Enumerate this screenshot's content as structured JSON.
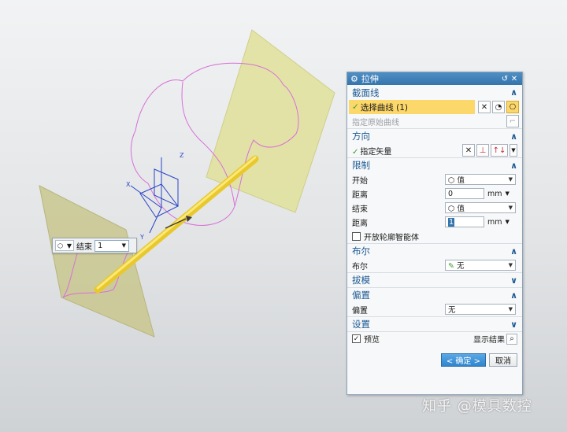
{
  "float_toolbar": {
    "label": "结束",
    "value": "1"
  },
  "dialog": {
    "title": "拉伸",
    "sections": {
      "section": {
        "header": "截面线",
        "select_curve": "选择曲线 (1)",
        "specify_original": "指定原始曲线"
      },
      "direction": {
        "header": "方向",
        "specify_vector": "指定矢量"
      },
      "limits": {
        "header": "限制",
        "start_label": "开始",
        "start_value": "值",
        "distance1_label": "距离",
        "distance1_value": "0",
        "distance1_unit": "mm",
        "end_label": "结束",
        "end_value": "值",
        "distance2_label": "距离",
        "distance2_value": "1",
        "distance2_unit": "mm",
        "open_profile": "开放轮廓智能体"
      },
      "boolean": {
        "header": "布尔",
        "label": "布尔",
        "value": "无"
      },
      "draft": {
        "header": "拔模"
      },
      "offset": {
        "header": "偏置",
        "label": "偏置",
        "value": "无"
      },
      "settings": {
        "header": "设置"
      }
    },
    "preview_label": "预览",
    "show_result": "显示结果",
    "ok": "< 确定 >",
    "cancel": "取消"
  },
  "watermark": "知乎 @模具数控",
  "axis_labels": {
    "z": "Z",
    "x": "X",
    "y": "Y"
  },
  "colors": {
    "accent": "#3575ad",
    "highlight": "#fcd76a",
    "section_text": "#1d5a93",
    "plane": "#e0e09a",
    "curve": "#d86fd8",
    "rod": "#f2d83a"
  }
}
